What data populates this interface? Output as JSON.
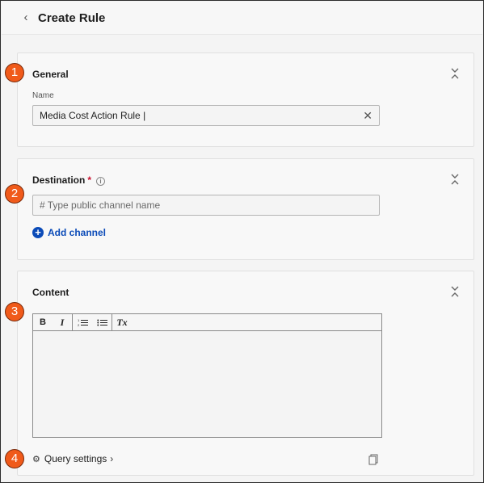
{
  "header": {
    "title": "Create Rule",
    "back_icon": "chevron-left-icon"
  },
  "general": {
    "title": "General",
    "name_label": "Name",
    "name_value": "Media Cost  Action Rule |",
    "clear_icon": "close-icon"
  },
  "destination": {
    "title": "Destination",
    "required_mark": "*",
    "info_icon_glyph": "i",
    "channel_placeholder_hash": "#",
    "channel_placeholder": "Type public channel name",
    "add_channel_label": "Add channel"
  },
  "content": {
    "title": "Content",
    "toolbar": {
      "bold": "B",
      "italic": "I",
      "clear_format": "Tx"
    },
    "query_settings_label": "Query settings",
    "editor_value": ""
  },
  "badges": [
    "1",
    "2",
    "3",
    "4"
  ],
  "colors": {
    "badge": "#f05a1a",
    "link": "#0b4bb8",
    "required": "#c8102e"
  }
}
